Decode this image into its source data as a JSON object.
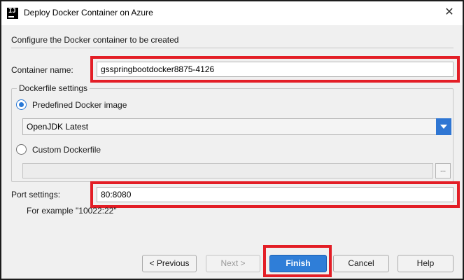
{
  "window": {
    "title": "Deploy Docker Container on Azure",
    "app_icon": "intellij-icon",
    "app_icon_glyph": "IJ",
    "close_glyph": "✕"
  },
  "header": {
    "text": "Configure the Docker container to be created"
  },
  "container": {
    "label": "Container name:",
    "value": "gsspringbootdocker8875-4126"
  },
  "dockerfile": {
    "group_title": "Dockerfile settings",
    "predefined_label": "Predefined Docker image",
    "predefined_selected": true,
    "image_options_selected": "OpenJDK Latest",
    "custom_label": "Custom Dockerfile",
    "custom_selected": false,
    "custom_path": "",
    "browse_label": "..."
  },
  "port": {
    "label": "Port settings:",
    "value": "80:8080",
    "hint": "For example \"10022:22\""
  },
  "buttons": {
    "previous": "< Previous",
    "next": "Next >",
    "finish": "Finish",
    "cancel": "Cancel",
    "help": "Help"
  },
  "colors": {
    "highlight": "#e31e26",
    "accent": "#2f7ed8"
  }
}
